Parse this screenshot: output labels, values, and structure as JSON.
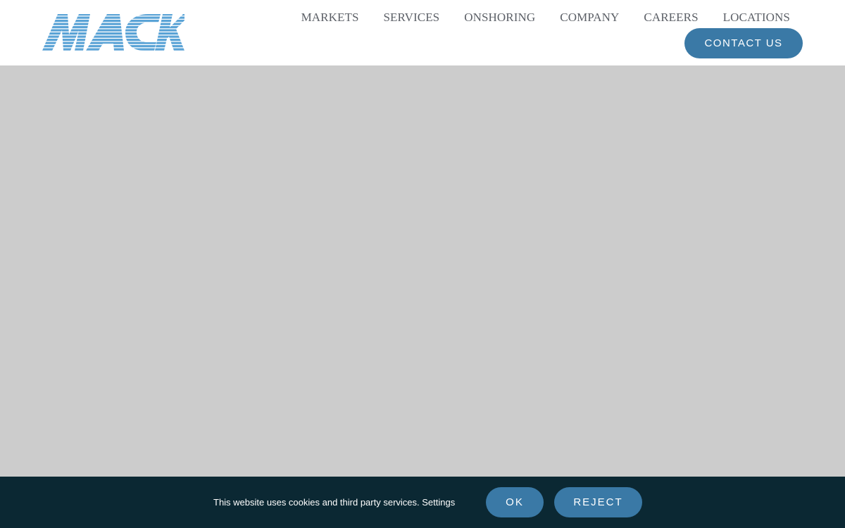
{
  "header": {
    "logo_text": "MACK",
    "nav": [
      {
        "label": "MARKETS"
      },
      {
        "label": "SERVICES"
      },
      {
        "label": "ONSHORING"
      },
      {
        "label": "COMPANY"
      },
      {
        "label": "CAREERS"
      },
      {
        "label": "LOCATIONS"
      }
    ],
    "contact_label": "CONTACT US"
  },
  "cookie": {
    "message": "This website uses cookies and third party services.",
    "settings_label": "Settings",
    "ok_label": "OK",
    "reject_label": "REJECT"
  },
  "colors": {
    "brand_blue": "#3a79a6",
    "logo_blue": "#5aa3d6",
    "hero_placeholder": "#cccccc",
    "cookie_bar": "#0b2833",
    "nav_text": "#5b5f66"
  }
}
